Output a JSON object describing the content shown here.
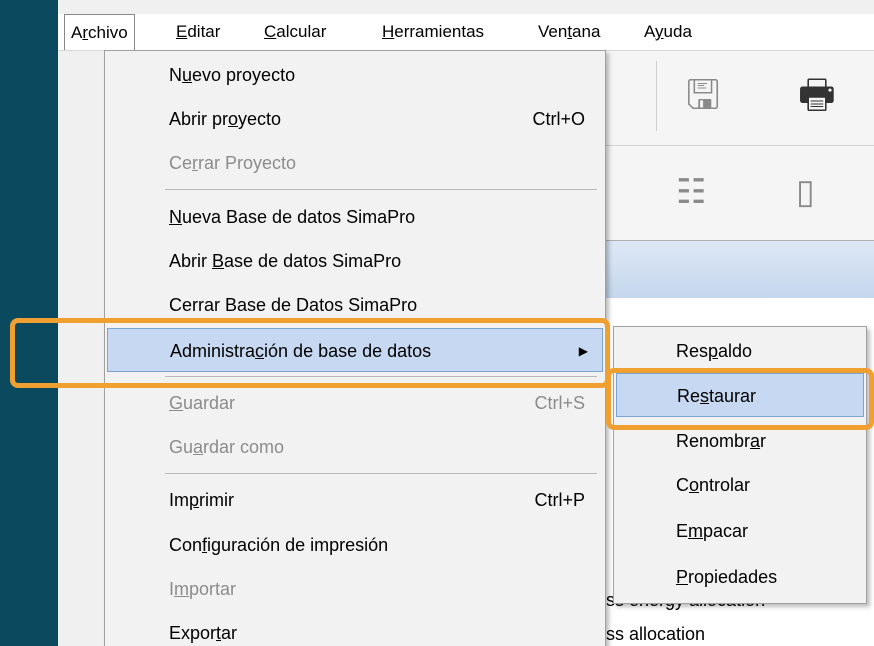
{
  "menubar": {
    "items": [
      {
        "label": "Archivo",
        "mn": "r"
      },
      {
        "label": "Editar",
        "mn": "E"
      },
      {
        "label": "Calcular",
        "mn": "C"
      },
      {
        "label": "Herramientas",
        "mn": "H"
      },
      {
        "label": "Ventana",
        "mn": "t"
      },
      {
        "label": "Ayuda",
        "mn": "y"
      }
    ]
  },
  "file_menu": {
    "items": [
      {
        "label": "Nuevo proyecto",
        "mn": "u",
        "shortcut": "",
        "disabled": false
      },
      {
        "label": "Abrir proyecto",
        "mn": "o",
        "shortcut": "Ctrl+O",
        "disabled": false
      },
      {
        "label": "Cerrar Proyecto",
        "mn": "r",
        "shortcut": "",
        "disabled": true
      },
      {
        "label": "Nueva Base de datos SimaPro",
        "mn": "N",
        "shortcut": "",
        "disabled": false
      },
      {
        "label": "Abrir Base de datos SimaPro",
        "mn": "B",
        "shortcut": "",
        "disabled": false
      },
      {
        "label": "Cerrar Base de Datos SimaPro",
        "mn": "",
        "shortcut": "",
        "disabled": false
      },
      {
        "label": "Administración de base de datos",
        "mn": "c",
        "shortcut": "",
        "disabled": false,
        "submenu": true
      },
      {
        "label": "Guardar",
        "mn": "G",
        "shortcut": "Ctrl+S",
        "disabled": true
      },
      {
        "label": "Guardar como",
        "mn": "a",
        "shortcut": "",
        "disabled": true
      },
      {
        "label": "Imprimir",
        "mn": "p",
        "shortcut": "Ctrl+P",
        "disabled": false
      },
      {
        "label": "Configuración de impresión",
        "mn": "f",
        "shortcut": "",
        "disabled": false
      },
      {
        "label": "Importar",
        "mn": "m",
        "shortcut": "",
        "disabled": true
      },
      {
        "label": "Exportar",
        "mn": "t",
        "shortcut": "",
        "disabled": false
      }
    ]
  },
  "db_submenu": {
    "items": [
      {
        "label": "Respaldo",
        "mn": "p"
      },
      {
        "label": "Restaurar",
        "mn": "s"
      },
      {
        "label": "Renombrar",
        "mn": "a"
      },
      {
        "label": "Controlar",
        "mn": "o"
      },
      {
        "label": "Empacar",
        "mn": "m"
      },
      {
        "label": "Propiedades",
        "mn": "P"
      }
    ]
  },
  "background": {
    "text_1": "ss energy allocation",
    "text_2": "ss allocation"
  },
  "colors": {
    "outer_bg": "#0b4a5e",
    "highlight_frame": "#f0a030",
    "selection": "#c7d9f2"
  }
}
